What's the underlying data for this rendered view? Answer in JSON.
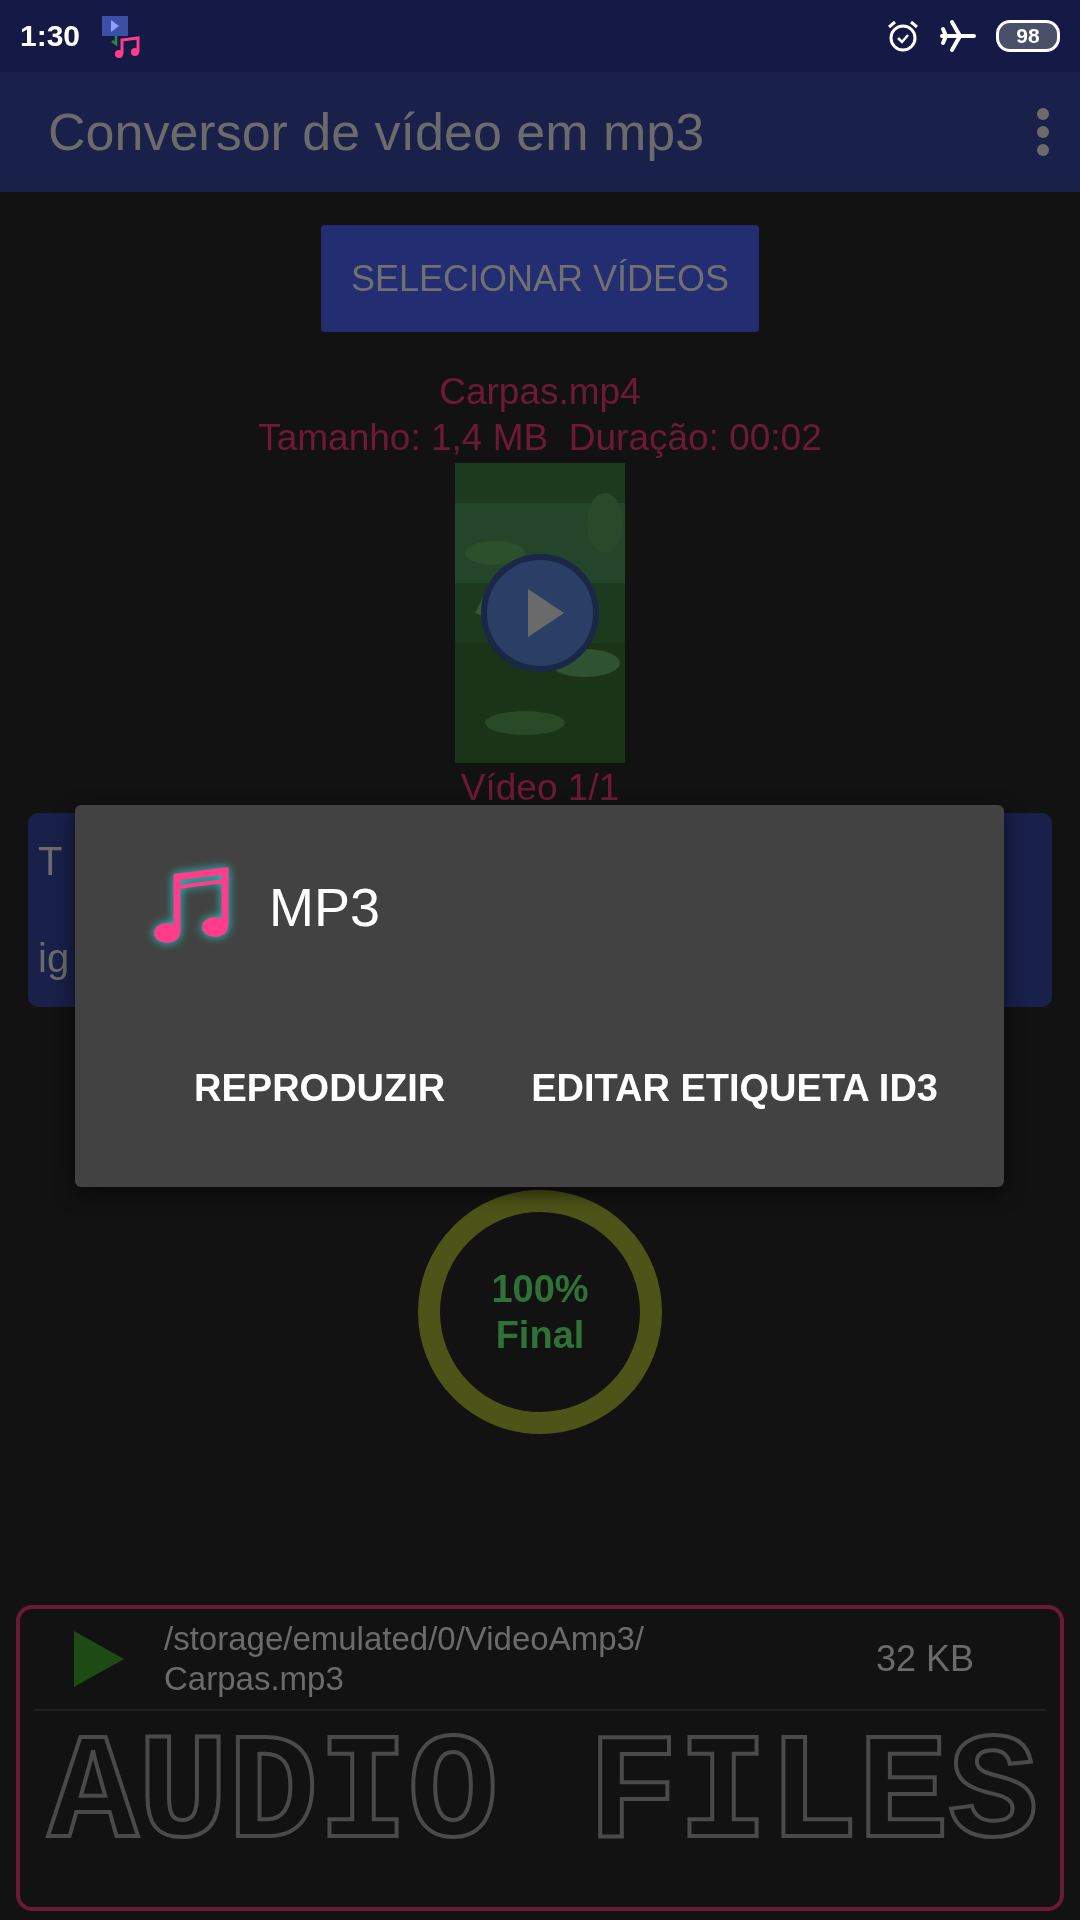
{
  "status_bar": {
    "time": "1:30",
    "battery": "98"
  },
  "app_bar": {
    "title": "Conversor de vídeo em mp3"
  },
  "select_button": "SELECIONAR VÍDEOS",
  "video": {
    "name": "Carpas.mp4",
    "details": "Tamanho: 1,4 MB  Duração: 00:02",
    "counter": "Vídeo 1/1"
  },
  "info_card": {
    "lines": [
      "T",
      "ig"
    ]
  },
  "progress": {
    "percent": "100%",
    "label": "Final"
  },
  "audio_files": {
    "watermark": "AUDIO FILES",
    "items": [
      {
        "path_lines": [
          "/storage/emulated/0/VideoAmp3/",
          "Carpas.mp3"
        ],
        "size": "32 KB"
      }
    ]
  },
  "dialog": {
    "title": "MP3",
    "buttons": [
      "REPRODUZIR",
      "EDITAR ETIQUETA ID3"
    ]
  }
}
